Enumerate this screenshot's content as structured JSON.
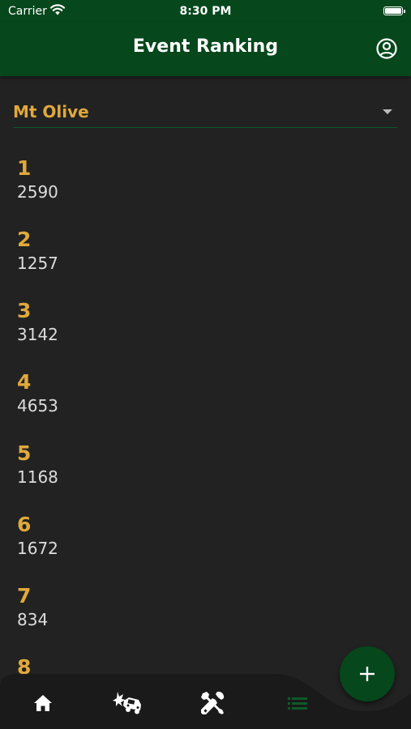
{
  "status_bar": {
    "carrier": "Carrier",
    "time": "8:30 PM"
  },
  "app_bar": {
    "title": "Event Ranking",
    "account_icon": "account-circle-icon"
  },
  "event_selector": {
    "value": "Mt Olive"
  },
  "rankings": [
    {
      "rank": "1",
      "team": "2590"
    },
    {
      "rank": "2",
      "team": "1257"
    },
    {
      "rank": "3",
      "team": "3142"
    },
    {
      "rank": "4",
      "team": "4653"
    },
    {
      "rank": "5",
      "team": "1168"
    },
    {
      "rank": "6",
      "team": "1672"
    },
    {
      "rank": "7",
      "team": "834"
    },
    {
      "rank": "8",
      "team": ""
    }
  ],
  "bottom_nav": {
    "items": [
      {
        "icon": "home-icon",
        "active": false
      },
      {
        "icon": "car-crash-icon",
        "active": false
      },
      {
        "icon": "tools-icon",
        "active": false
      },
      {
        "icon": "list-icon",
        "active": true
      }
    ]
  },
  "fab": {
    "icon": "plus-icon"
  },
  "colors": {
    "primary": "#06471c",
    "accent": "#e0a93a",
    "background": "#222222",
    "nav_background": "#1a1a1a"
  }
}
